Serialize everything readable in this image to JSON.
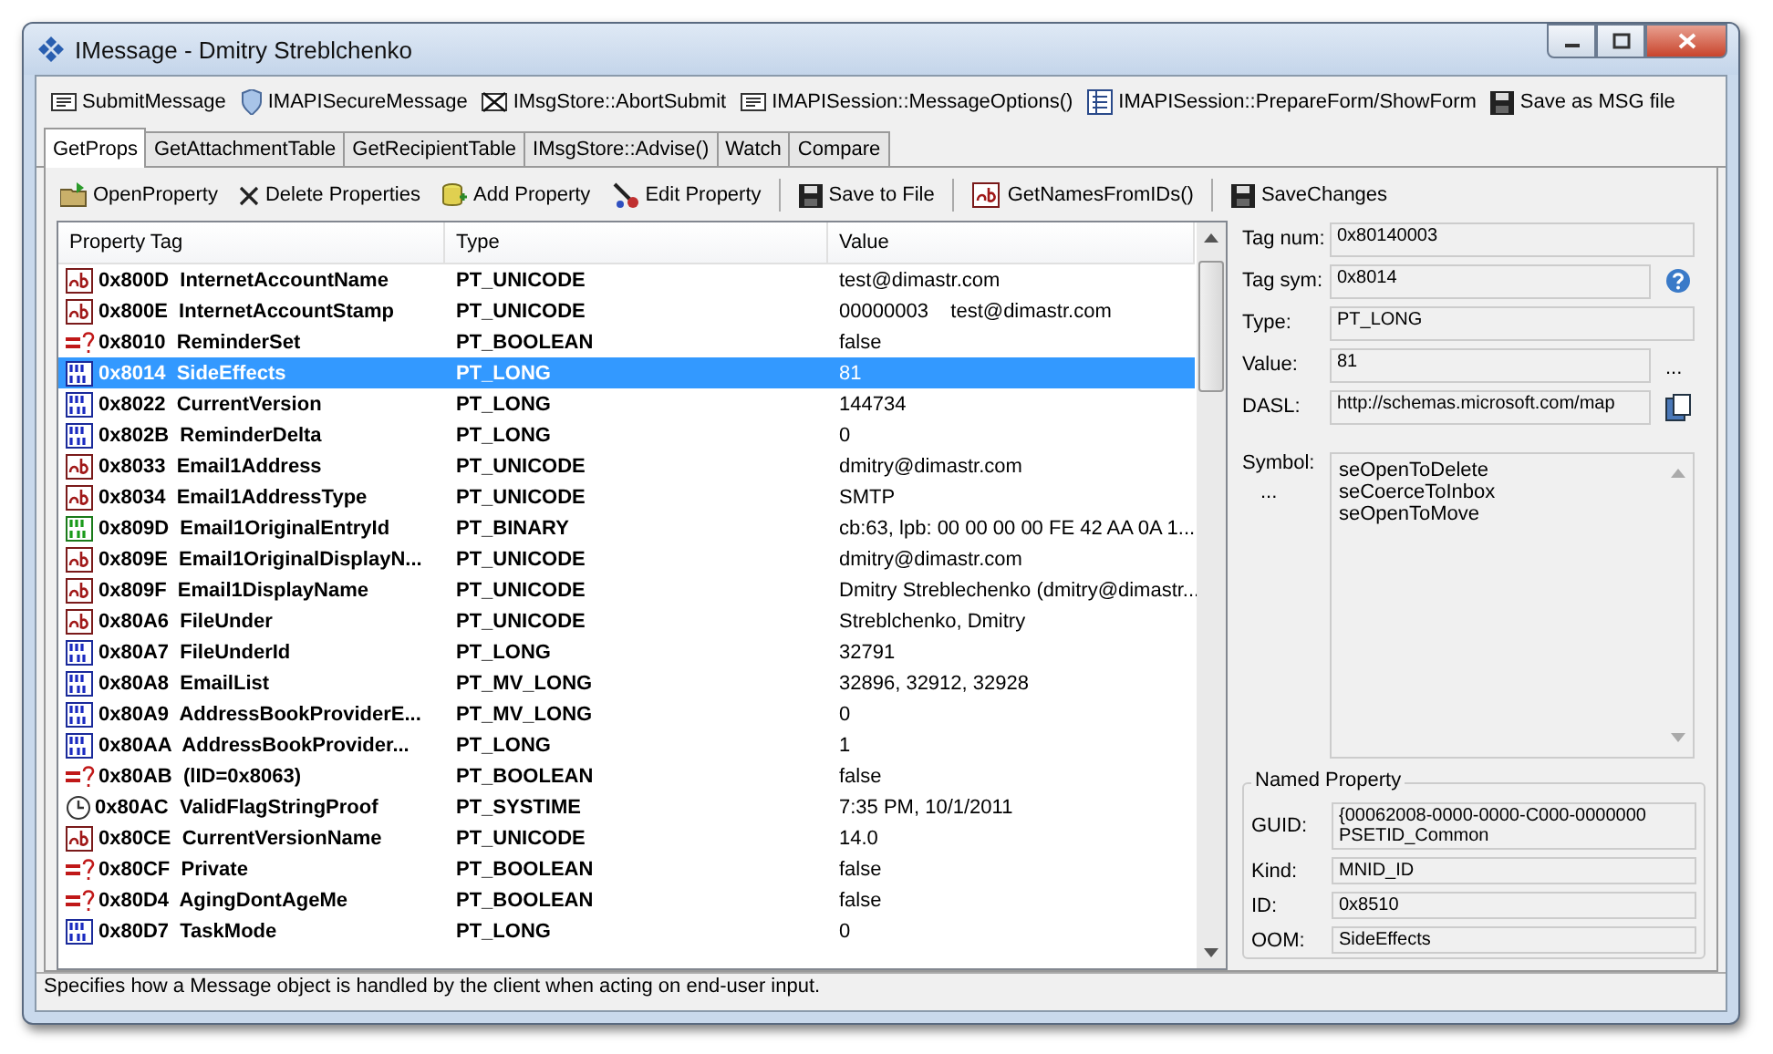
{
  "window": {
    "title": "IMessage - Dmitry Streblchenko"
  },
  "toolbar": [
    {
      "label": "SubmitMessage",
      "kind": "message"
    },
    {
      "label": "IMAPISecureMessage",
      "kind": "shield"
    },
    {
      "label": "IMsgStore::AbortSubmit",
      "kind": "crossed"
    },
    {
      "label": "IMAPISession::MessageOptions()",
      "kind": "message"
    },
    {
      "label": "IMAPISession::PrepareForm/ShowForm",
      "kind": "form"
    },
    {
      "label": "Save as MSG file",
      "kind": "save"
    }
  ],
  "tabs": [
    {
      "label": "GetProps",
      "selected": true
    },
    {
      "label": "GetAttachmentTable",
      "selected": false
    },
    {
      "label": "GetRecipientTable",
      "selected": false
    },
    {
      "label": "IMsgStore::Advise()",
      "selected": false
    },
    {
      "label": "Watch",
      "selected": false
    },
    {
      "label": "Compare",
      "selected": false
    }
  ],
  "actions": [
    {
      "label": "OpenProperty",
      "kind": "open"
    },
    {
      "label": "Delete Properties",
      "kind": "delete"
    },
    {
      "label": "Add Property",
      "kind": "add"
    },
    {
      "label": "Edit Property",
      "kind": "edit"
    },
    {
      "label": "Save to File",
      "kind": "save",
      "separator_before": true
    },
    {
      "label": "GetNamesFromIDs()",
      "kind": "string",
      "separator_before": true
    },
    {
      "label": "SaveChanges",
      "kind": "save",
      "separator_before": true
    }
  ],
  "table": {
    "columns": [
      "Property Tag",
      "Type",
      "Value"
    ],
    "rows": [
      {
        "kind": "string",
        "tag": "0x800D  InternetAccountName",
        "type": "PT_UNICODE",
        "value": "test@dimastr.com",
        "selected": false
      },
      {
        "kind": "string",
        "tag": "0x800E  InternetAccountStamp",
        "type": "PT_UNICODE",
        "value": "00000003    test@dimastr.com",
        "selected": false
      },
      {
        "kind": "boolean",
        "tag": "0x8010  ReminderSet",
        "type": "PT_BOOLEAN",
        "value": "false",
        "selected": false
      },
      {
        "kind": "long",
        "tag": "0x8014  SideEffects",
        "type": "PT_LONG",
        "value": "81",
        "selected": true
      },
      {
        "kind": "long",
        "tag": "0x8022  CurrentVersion",
        "type": "PT_LONG",
        "value": "144734",
        "selected": false
      },
      {
        "kind": "long",
        "tag": "0x802B  ReminderDelta",
        "type": "PT_LONG",
        "value": "0",
        "selected": false
      },
      {
        "kind": "string",
        "tag": "0x8033  Email1Address",
        "type": "PT_UNICODE",
        "value": "dmitry@dimastr.com",
        "selected": false
      },
      {
        "kind": "string",
        "tag": "0x8034  Email1AddressType",
        "type": "PT_UNICODE",
        "value": "SMTP",
        "selected": false
      },
      {
        "kind": "binary",
        "tag": "0x809D  Email1OriginalEntryId",
        "type": "PT_BINARY",
        "value": "cb:63, lpb: 00 00 00 00 FE 42 AA 0A 1...",
        "selected": false
      },
      {
        "kind": "string",
        "tag": "0x809E  Email1OriginalDisplayN...",
        "type": "PT_UNICODE",
        "value": "dmitry@dimastr.com",
        "selected": false
      },
      {
        "kind": "string",
        "tag": "0x809F  Email1DisplayName",
        "type": "PT_UNICODE",
        "value": "Dmitry Streblechenko (dmitry@dimastr...",
        "selected": false
      },
      {
        "kind": "string",
        "tag": "0x80A6  FileUnder",
        "type": "PT_UNICODE",
        "value": "Streblchenko, Dmitry",
        "selected": false
      },
      {
        "kind": "long",
        "tag": "0x80A7  FileUnderId",
        "type": "PT_LONG",
        "value": "32791",
        "selected": false
      },
      {
        "kind": "long",
        "tag": "0x80A8  EmailList",
        "type": "PT_MV_LONG",
        "value": "32896, 32912, 32928",
        "selected": false
      },
      {
        "kind": "long",
        "tag": "0x80A9  AddressBookProviderE...",
        "type": "PT_MV_LONG",
        "value": "0",
        "selected": false
      },
      {
        "kind": "long",
        "tag": "0x80AA  AddressBookProvider...",
        "type": "PT_LONG",
        "value": "1",
        "selected": false
      },
      {
        "kind": "boolean",
        "tag": "0x80AB  (lID=0x8063)",
        "type": "PT_BOOLEAN",
        "value": "false",
        "selected": false
      },
      {
        "kind": "time",
        "tag": "0x80AC  ValidFlagStringProof",
        "type": "PT_SYSTIME",
        "value": "7:35 PM, 10/1/2011",
        "selected": false
      },
      {
        "kind": "string",
        "tag": "0x80CE  CurrentVersionName",
        "type": "PT_UNICODE",
        "value": "14.0",
        "selected": false
      },
      {
        "kind": "boolean",
        "tag": "0x80CF  Private",
        "type": "PT_BOOLEAN",
        "value": "false",
        "selected": false
      },
      {
        "kind": "boolean",
        "tag": "0x80D4  AgingDontAgeMe",
        "type": "PT_BOOLEAN",
        "value": "false",
        "selected": false
      },
      {
        "kind": "long",
        "tag": "0x80D7  TaskMode",
        "type": "PT_LONG",
        "value": "0",
        "selected": false
      }
    ]
  },
  "details": {
    "fields": [
      {
        "label": "Tag num:",
        "value": "0x80140003",
        "kind": "plain"
      },
      {
        "label": "Tag sym:",
        "value": "0x8014",
        "kind": "help"
      },
      {
        "label": "Type:",
        "value": "PT_LONG",
        "kind": "plain"
      },
      {
        "label": "Value:",
        "value": "81",
        "kind": "more",
        "more_text": "..."
      },
      {
        "label": "DASL:",
        "value": "http://schemas.microsoft.com/map",
        "kind": "copy"
      }
    ],
    "symbol": {
      "label": "Symbol:",
      "more": "...",
      "lines": [
        "seOpenToDelete",
        "seCoerceToInbox",
        "seOpenToMove"
      ]
    },
    "named_property": {
      "title": "Named Property",
      "fields": [
        {
          "label": "GUID:",
          "lines": [
            "{00062008-0000-0000-C000-0000000",
            "PSETID_Common"
          ]
        },
        {
          "label": "Kind:",
          "lines": [
            "MNID_ID"
          ]
        },
        {
          "label": "ID:",
          "lines": [
            "0x8510"
          ]
        },
        {
          "label": "OOM:",
          "lines": [
            "SideEffects"
          ]
        }
      ]
    }
  },
  "status_bar": "Specifies how a Message object is handled by the client when acting on end-user input."
}
